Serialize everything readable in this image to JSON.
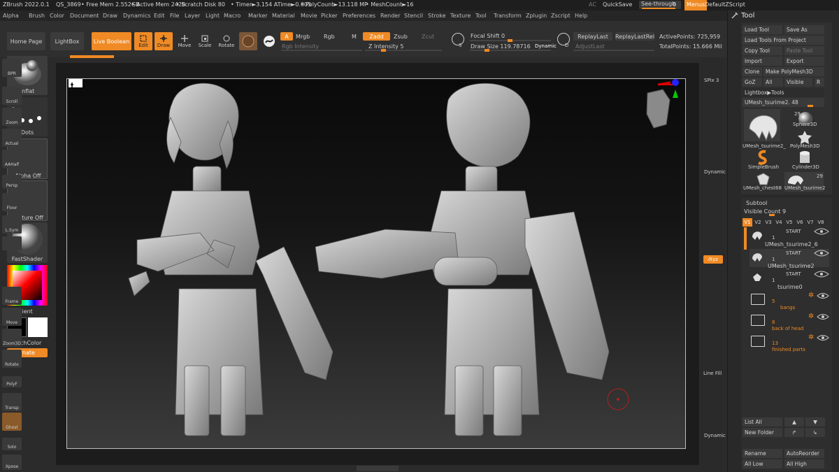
{
  "titlebar": {
    "app": "ZBrush 2022.0.1",
    "doc": "QS_3869",
    "free_mem": "• Free Mem 2.552GB",
    "active_mem": "• Active Mem 2428",
    "scratch": "• Scratch Disk 80",
    "timer": "• Timer►3.154 ATime►0.005",
    "polycount": "• PolyCount►13.118 MP",
    "meshcount": "• MeshCount►16",
    "ac": "AC",
    "quicksave": "QuickSave",
    "seethrough": "See-through",
    "seethrough_val": "0",
    "menus": "Menus",
    "defaultzscript": "DefaultZScript"
  },
  "menus": [
    "Alpha",
    "Brush",
    "Color",
    "Document",
    "Draw",
    "Dynamics",
    "Edit",
    "File",
    "Layer",
    "Light",
    "Macro",
    "Marker",
    "Material",
    "Movie",
    "Picker",
    "Preferences",
    "Render",
    "Stencil",
    "Stroke",
    "Texture",
    "Tool",
    "Transform",
    "Zplugin",
    "Zscript",
    "Help"
  ],
  "topshelf": {
    "home": "Home Page",
    "lightbox": "LightBox",
    "liveboolean": "Live Boolean",
    "edit": "Edit",
    "draw": "Draw",
    "move": "Move",
    "scale": "Scale",
    "rotate": "Rotate",
    "a": "A",
    "mrgb": "Mrgb",
    "rgb": "Rgb",
    "m": "M",
    "zadd": "Zadd",
    "zsub": "Zsub",
    "zcut": "Zcut",
    "rgb_intensity": "Rgb Intensity",
    "z_intensity": "Z Intensity 5",
    "focal_shift": "Focal Shift 0",
    "draw_size": "Draw Size 119.78716",
    "dynamic": "Dynamic",
    "s": "S",
    "d": "D",
    "replaylast": "ReplayLast",
    "replaylastrel": "ReplayLastRel",
    "adjustlast": "AdjustLast",
    "activepoints": "ActivePoints: 725,959",
    "totalpoints": "TotalPoints: 15.666 Mil"
  },
  "leftshelf": {
    "inflat": "Inflat",
    "dots": "Dots",
    "alpha_off": "Alpha Off",
    "texture_off": "Texture Off",
    "fastshader": "FastShader",
    "gradient": "Gradient",
    "switchcolor": "SwitchColor",
    "alternate": "Alternate"
  },
  "rightshelf": {
    "bpr": "BPR",
    "spix": "SPix 3",
    "scroll": "Scroll",
    "zoom": "Zoom",
    "actual": "Actual",
    "aahalf": "AAHalf",
    "dynamic": "Dynamic",
    "persp": "Persp",
    "floor": "Floor",
    "lsym": "L.Sym",
    "xyz": "⁄Xyz",
    "frame": "Frame",
    "move": "Move",
    "zoom3d": "Zoom3D",
    "rotate": "Rotate",
    "linefill": "Line Fill",
    "polyf": "PolyF",
    "transp": "Transp",
    "ghost": "Ghost",
    "dynamic2": "Dynamic",
    "solo": "Solo",
    "xpose": "Xpose"
  },
  "tool": {
    "title": "Tool",
    "load_tool": "Load Tool",
    "save_as": "Save As",
    "load_from_project": "Load Tools From Project",
    "copy_tool": "Copy Tool",
    "paste_tool": "Paste Tool",
    "import": "Import",
    "export": "Export",
    "clone": "Clone",
    "make_polymesh": "Make PolyMesh3D",
    "goz": "GoZ",
    "all": "All",
    "visible": "Visible",
    "r": "R",
    "lightbox_tools": "Lightbox▶Tools",
    "current_tool": "UMesh_tsurime2. 48",
    "thumbs": [
      {
        "label": "UMesh_tsurime2_",
        "count": "29"
      },
      {
        "label": "Sphere3D",
        "count": ""
      },
      {
        "label": "PolyMesh3D",
        "count": ""
      },
      {
        "label": "SimpleBrush",
        "count": ""
      },
      {
        "label": "Cylinder3D",
        "count": ""
      },
      {
        "label": "UMesh_chest68",
        "count": ""
      },
      {
        "label": "UMesh_tsurime2",
        "count": "29"
      }
    ]
  },
  "subtool": {
    "title": "Subtool",
    "visible_count": "Visible Count 9",
    "v_tabs": [
      "V1",
      "V2",
      "V3",
      "V4",
      "V5",
      "V6",
      "V7",
      "V8"
    ],
    "start": "START",
    "items": [
      {
        "name": "UMesh_tsurime2_6",
        "num": "1"
      },
      {
        "name": "UMesh_tsurime2",
        "num": "1"
      },
      {
        "name": "tsurime0",
        "num": "1"
      }
    ],
    "folders": [
      {
        "count": "5",
        "name": "bangs"
      },
      {
        "count": "8",
        "name": "back of head"
      },
      {
        "count": "13",
        "name": "finished parts"
      }
    ],
    "list_all": "List All",
    "new_folder": "New Folder",
    "rename": "Rename",
    "autoreorder": "AutoReorder",
    "all_low": "All Low",
    "all_high": "All High"
  },
  "colors": {
    "accent": "#f08a24",
    "bg": "#2b2b2b",
    "button": "#3a3a3a"
  }
}
